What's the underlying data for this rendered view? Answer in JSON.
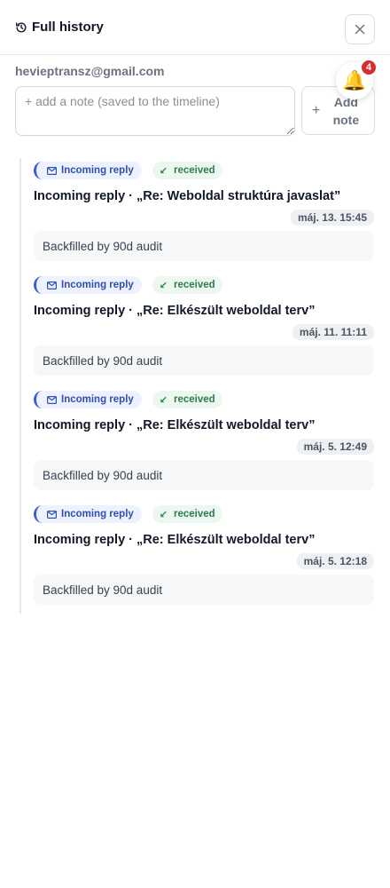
{
  "header": {
    "title": "Full history",
    "close_icon": "close-icon",
    "history_icon": "history-icon"
  },
  "contact": {
    "email": "hevieptransz@gmail.com"
  },
  "notifications": {
    "count": "4",
    "icon": "bell-icon"
  },
  "note_form": {
    "placeholder": "+ add a note (saved to the timeline)",
    "value": "",
    "add_label": "Add note",
    "add_icon": "plus-icon"
  },
  "timeline": {
    "entries": [
      {
        "type_label": "Incoming reply",
        "status_label": "received",
        "title": "Incoming reply · „Re: Weboldal struktúra javaslat”",
        "timestamp": "máj. 13. 15:45",
        "note": "Backfilled by 90d audit"
      },
      {
        "type_label": "Incoming reply",
        "status_label": "received",
        "title": "Incoming reply · „Re: Elkészült weboldal terv”",
        "timestamp": "máj. 11. 11:11",
        "note": "Backfilled by 90d audit"
      },
      {
        "type_label": "Incoming reply",
        "status_label": "received",
        "title": "Incoming reply · „Re: Elkészült weboldal terv”",
        "timestamp": "máj. 5. 12:49",
        "note": "Backfilled by 90d audit"
      },
      {
        "type_label": "Incoming reply",
        "status_label": "received",
        "title": "Incoming reply · „Re: Elkészült weboldal terv”",
        "timestamp": "máj. 5. 12:18",
        "note": "Backfilled by 90d audit"
      }
    ]
  },
  "colors": {
    "incoming_accent": "#3b5bdb",
    "received_text": "#2e7d4f",
    "badge_red": "#d32f2f",
    "bell": "#f5b400"
  }
}
